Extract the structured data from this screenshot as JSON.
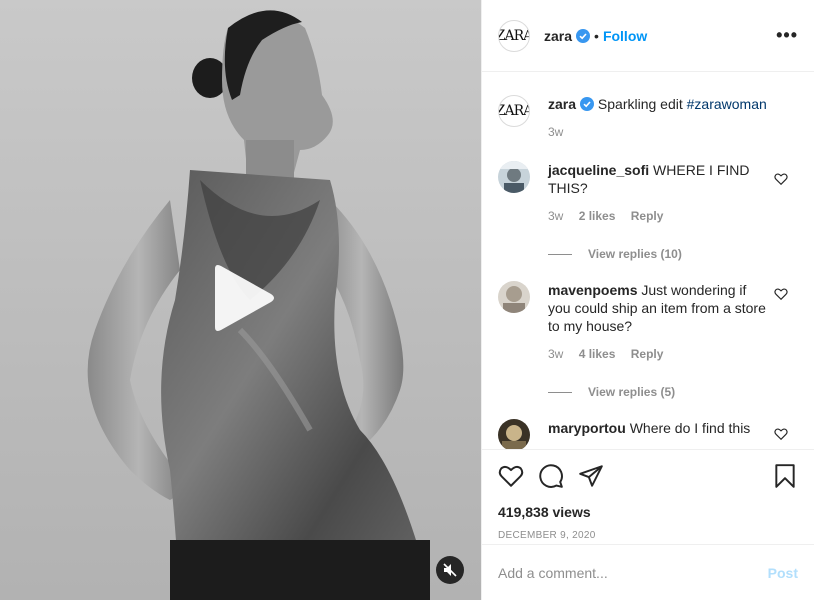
{
  "post": {
    "account": "zara",
    "avatar_text": "ZARA",
    "follow_label": "Follow",
    "dot": "•",
    "more_label": "•••",
    "caption_text": "Sparkling edit",
    "caption_hashtag": "#zarawoman",
    "caption_time": "3w",
    "views": "419,838 views",
    "date": "DECEMBER 9, 2020",
    "add_comment_placeholder": "Add a comment...",
    "post_label": "Post"
  },
  "comments": [
    {
      "username": "jacqueline_sofi",
      "text": "WHERE I FIND THIS?",
      "time": "3w",
      "likes": "2 likes",
      "reply": "Reply",
      "view_replies": "View replies (10)"
    },
    {
      "username": "mavenpoems",
      "text": "Just wondering if you could ship an item from a store to my house?",
      "time": "3w",
      "likes": "4 likes",
      "reply": "Reply",
      "view_replies": "View replies (5)"
    },
    {
      "username": "maryportou",
      "text": "Where do I find this"
    }
  ],
  "colors": {
    "accent": "#0095f6",
    "verified": "#3897f0",
    "muted": "#8e8e8e",
    "post_disabled": "#b2dffc"
  },
  "icons": [
    "verified-badge-icon",
    "more-options-icon",
    "heart-icon",
    "comment-icon",
    "share-icon",
    "bookmark-icon",
    "play-icon",
    "mute-icon"
  ]
}
